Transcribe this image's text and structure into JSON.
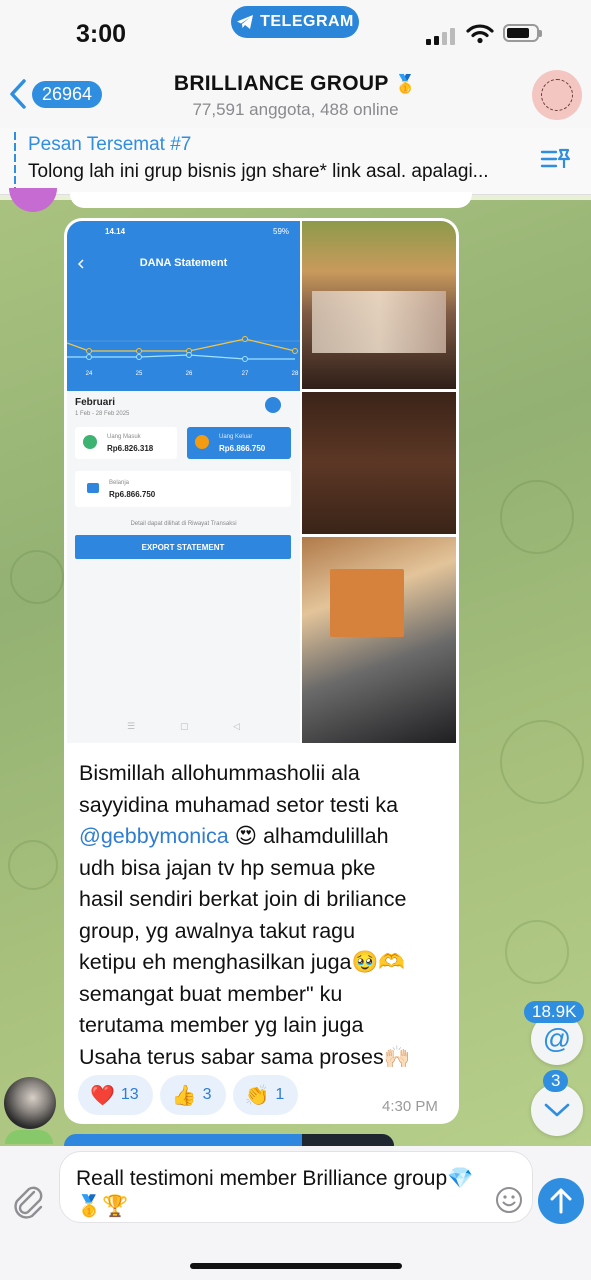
{
  "status_bar": {
    "time": "3:00",
    "telegram_pill": "TELEGRAM"
  },
  "header": {
    "back_count": "26964",
    "title": "BRILLIANCE GROUP",
    "title_emoji": "🥇",
    "subtitle": "77,591 anggota, 488 online"
  },
  "pinned": {
    "title": "Pesan Tersemat #7",
    "text": "Tolong lah ini grup bisnis jgn share* link asal. apalagi..."
  },
  "message": {
    "screenshot": {
      "status_time": "14.14",
      "status_battery": "59%",
      "heading": "DANA Statement",
      "x_ticks": [
        "24",
        "25",
        "26",
        "27",
        "28"
      ],
      "month": "Februari",
      "range": "1 Feb - 28 Feb 2025",
      "in_label": "Uang Masuk",
      "in_amount": "Rp6.826.318",
      "out_label": "Uang Keluar",
      "out_amount": "Rp6.866.750",
      "shop_label": "Belanja",
      "shop_amount": "Rp6.866.750",
      "note": "Detail dapat dilihat di Riwayat Transaksi",
      "export_button": "EXPORT STATEMENT"
    },
    "text_before": "Bismillah allohummasholii ala\nsayyidina muhamad setor testi ka",
    "mention": "@gebbymonica",
    "text_after": " 😍 alhamdulillah\nudh bisa jajan tv hp semua pke\nhasil sendiri berkat join di briliance\ngroup, yg awalnya takut ragu\nketipu eh menghasilkan juga🥹🫶\nsemangat buat member\" ku\nterutama member yg lain juga\nUsaha terus sabar sama proses🙌🏻",
    "reactions": [
      {
        "emoji": "❤️",
        "count": "13"
      },
      {
        "emoji": "👍",
        "count": "3"
      },
      {
        "emoji": "👏",
        "count": "1"
      }
    ],
    "time": "4:30 PM"
  },
  "fabs": {
    "mentions_badge": "18.9K",
    "unread_badge": "3"
  },
  "composer": {
    "text": "Reall testimoni member Brilliance group💎🥇🏆"
  },
  "colors": {
    "accent": "#2f8ee0",
    "chat_bg": "#a3bd7e",
    "dana_blue": "#2e86de"
  }
}
